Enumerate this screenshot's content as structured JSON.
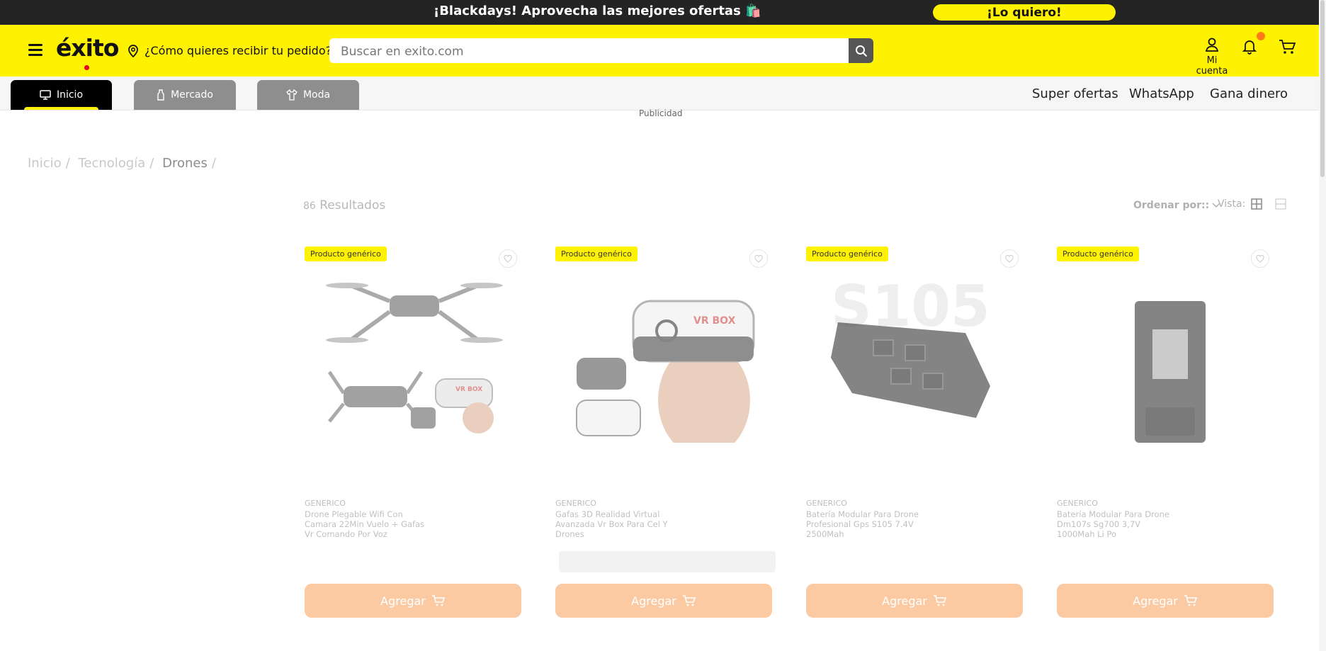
{
  "promo": {
    "text": "¡Blackdays! Aprovecha las mejores ofertas 🛍️",
    "cta": "¡Lo quiero!"
  },
  "header": {
    "logo": "éxito",
    "location": "¿Cómo quieres recibir tu pedido?",
    "search_placeholder": "Buscar en exito.com",
    "account_label": "Mi cuenta"
  },
  "tabs": [
    {
      "label": "Inicio",
      "icon": "monitor-icon",
      "active": true
    },
    {
      "label": "Mercado",
      "icon": "bottle-icon",
      "active": false
    },
    {
      "label": "Moda",
      "icon": "shirt-icon",
      "active": false
    }
  ],
  "nav_links": [
    "Super ofertas",
    "WhatsApp",
    "Gana dinero"
  ],
  "ad_label": "Publicidad",
  "breadcrumb": [
    "Inicio",
    "Tecnología",
    "Drones"
  ],
  "results": {
    "count": "86",
    "label": "Resultados"
  },
  "sort_label": "Ordenar por::",
  "view_label": "Vista:",
  "products": [
    {
      "tag": "Producto genérico",
      "brand": "GENERICO",
      "name": "Drone Plegable Wifi Con Camara 22Min Vuelo + Gafas Vr Comando Por Voz",
      "image": "drone-with-vr-goggles",
      "button": "Agregar"
    },
    {
      "tag": "Producto genérico",
      "brand": "GENERICO",
      "name": "Gafas 3D Realidad Virtual Avanzada Vr Box Para Cel Y Drones",
      "image": "vr-box-goggles",
      "image_text": "VR BOX",
      "button": "Agregar"
    },
    {
      "tag": "Producto genérico",
      "brand": "GENERICO",
      "name": "Batería Modular Para Drone Profesional Gps S105 7.4V 2500Mah",
      "image": "drone-battery-s105",
      "image_text": "S105",
      "button": "Agregar"
    },
    {
      "tag": "Producto genérico",
      "brand": "GENERICO",
      "name": "Batería Modular Para Drone Dm107s Sg700 3,7V 1000Mah Li Po",
      "image": "drone-battery-dm107s",
      "button": "Agregar"
    }
  ]
}
